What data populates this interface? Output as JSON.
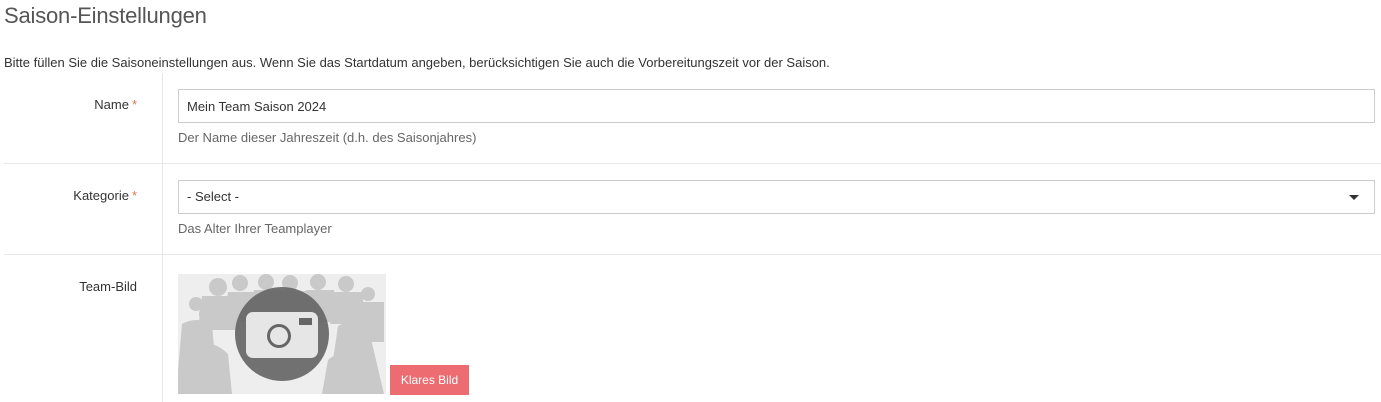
{
  "page": {
    "title": "Saison-Einstellungen",
    "intro": "Bitte füllen Sie die Saisoneinstellungen aus. Wenn Sie das Startdatum angeben, berücksichtigen Sie auch die Vorbereitungszeit vor der Saison."
  },
  "form": {
    "name": {
      "label": "Name",
      "required_marker": "*",
      "value": "Mein Team Saison 2024",
      "help": "Der Name dieser Jahreszeit (d.h. des Saisonjahres)"
    },
    "category": {
      "label": "Kategorie",
      "required_marker": "*",
      "selected": "- Select -",
      "help": "Das Alter Ihrer Teamplayer"
    },
    "team_image": {
      "label": "Team-Bild",
      "placeholder_icon": "camera-icon",
      "clear_button": "Klares Bild"
    }
  },
  "colors": {
    "required": "#e0734f",
    "clear_button": "#ec6c72",
    "border": "#cccccc"
  }
}
